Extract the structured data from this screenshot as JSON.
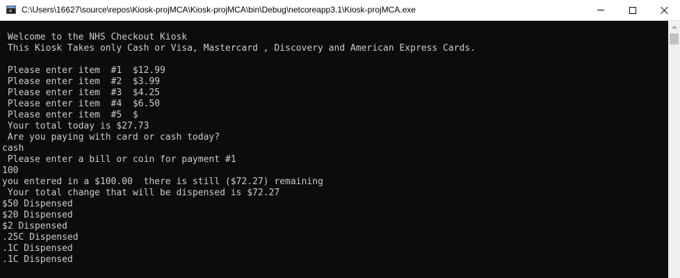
{
  "window": {
    "title": "C:\\Users\\16627\\source\\repos\\Kiosk-projMCA\\Kiosk-projMCA\\bin\\Debug\\netcoreapp3.1\\Kiosk-projMCA.exe",
    "app_icon": "console-app-icon",
    "controls": {
      "minimize": "minimize-icon",
      "maximize": "maximize-icon",
      "close": "close-icon"
    }
  },
  "console": {
    "foreground": "#cccccc",
    "background": "#0c0c0c",
    "lines": [
      "",
      " Welcome to the NHS Checkout Kiosk",
      " This Kiosk Takes only Cash or Visa, Mastercard , Discovery and American Express Cards.",
      "",
      " Please enter item  #1  $12.99",
      " Please enter item  #2  $3.99",
      " Please enter item  #3  $4.25",
      " Please enter item  #4  $6.50",
      " Please enter item  #5  $",
      " Your total today is $27.73",
      " Are you paying with card or cash today?",
      "cash",
      " Please enter a bill or coin for payment #1",
      "100",
      "you entered in a $100.00  there is still ($72.27) remaining",
      " Your total change that will be dispensed is $72.27",
      "$50 Dispensed",
      "$20 Dispensed",
      "$2 Dispensed",
      ".25C Dispensed",
      ".1C Dispensed",
      ".1C Dispensed"
    ]
  }
}
